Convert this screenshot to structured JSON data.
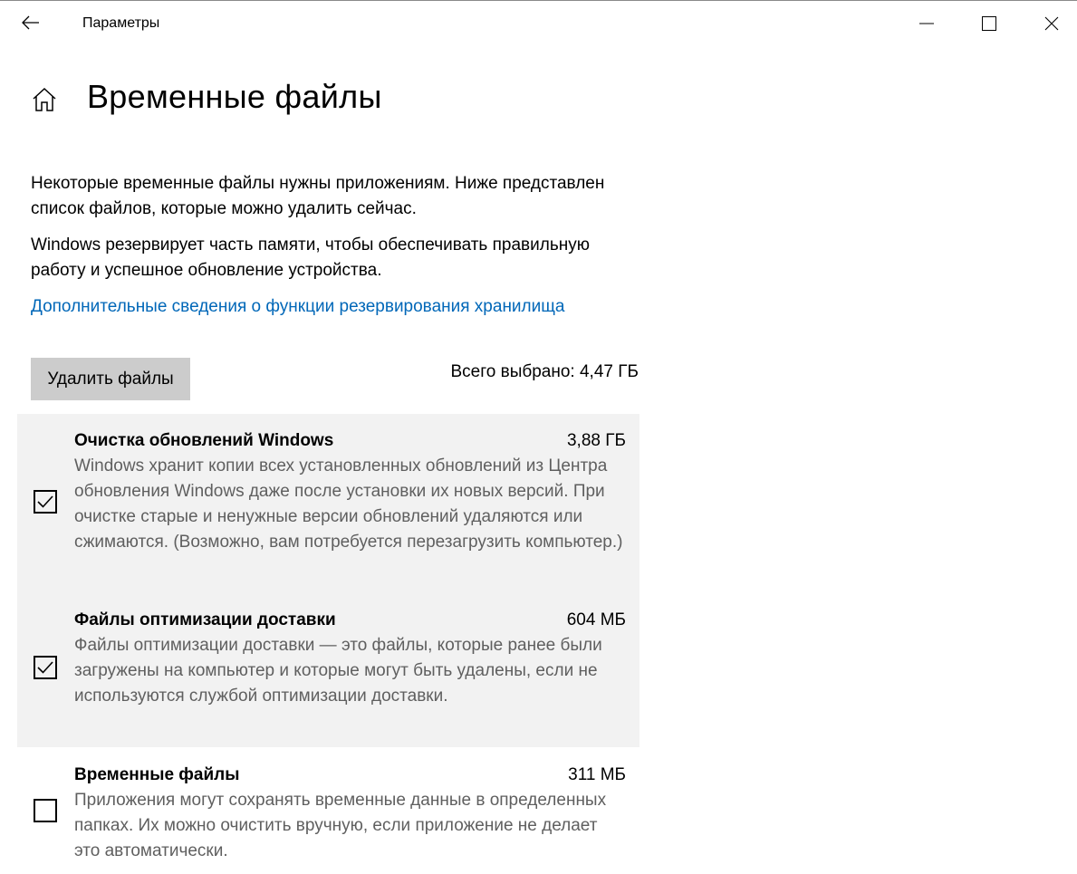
{
  "window": {
    "app_title": "Параметры",
    "icons": {
      "back": "back-arrow-icon",
      "minimize": "minimize-icon",
      "maximize": "maximize-icon",
      "close": "close-icon"
    }
  },
  "header": {
    "home_icon": "home-icon",
    "title": "Временные файлы"
  },
  "intro": {
    "paragraph1": "Некоторые временные файлы нужны приложениям. Ниже представлен список файлов, которые можно удалить сейчас.",
    "paragraph2": "Windows резервирует часть памяти, чтобы обеспечивать правильную работу и успешное обновление устройства.",
    "link": "Дополнительные сведения о функции резервирования хранилища"
  },
  "actions": {
    "delete_button": "Удалить файлы",
    "total_selected": "Всего выбрано: 4,47 ГБ"
  },
  "items": [
    {
      "name": "Очистка обновлений Windows",
      "size": "3,88 ГБ",
      "description": "Windows хранит копии всех установленных обновлений из Центра обновления Windows даже после установки их новых версий. При очистке старые и ненужные версии обновлений удаляются или сжимаются. (Возможно, вам потребуется перезагрузить компьютер.)",
      "checked": true
    },
    {
      "name": "Файлы оптимизации доставки",
      "size": "604 МБ",
      "description": "Файлы оптимизации доставки — это файлы, которые ранее были загружены на компьютер и которые могут быть удалены, если не используются службой оптимизации доставки.",
      "checked": true
    },
    {
      "name": "Временные файлы",
      "size": "311 МБ",
      "description": "Приложения могут сохранять временные данные в определенных папках. Их можно очистить вручную, если приложение не делает это автоматически.",
      "checked": false
    }
  ],
  "colors": {
    "link": "#0067b8",
    "button_bg": "#cccccc",
    "selected_item_bg": "#f2f2f2",
    "description_text": "#5f5f5f"
  }
}
